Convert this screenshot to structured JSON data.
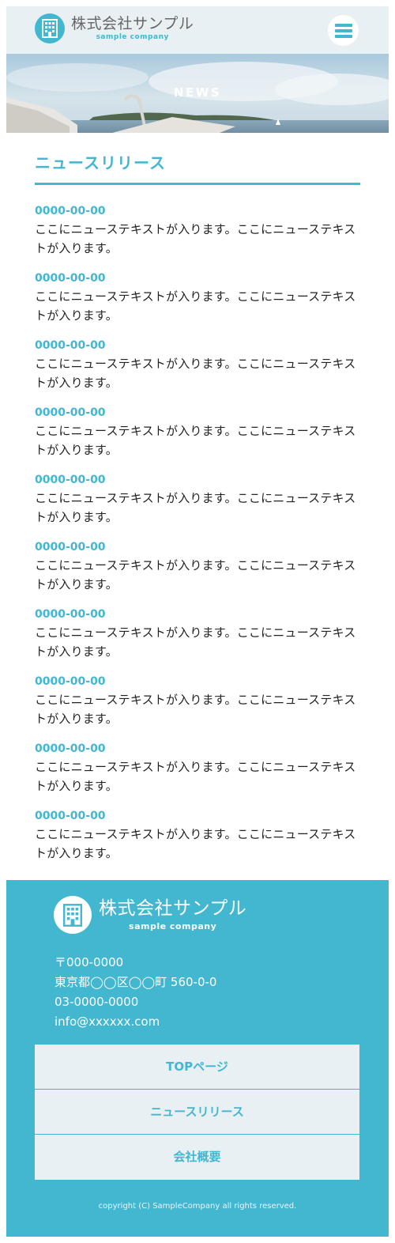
{
  "header": {
    "company_name": "株式会社サンプル",
    "company_sub": "sample company",
    "menu_icon": "hamburger-menu-icon",
    "logo_icon": "building-icon"
  },
  "hero": {
    "title": "NEWS"
  },
  "main": {
    "section_title": "ニュースリリース",
    "news": [
      {
        "date": "0000-00-00",
        "text": "ここにニューステキストが入ります。ここにニューステキストが入ります。"
      },
      {
        "date": "0000-00-00",
        "text": "ここにニューステキストが入ります。ここにニューステキストが入ります。"
      },
      {
        "date": "0000-00-00",
        "text": "ここにニューステキストが入ります。ここにニューステキストが入ります。"
      },
      {
        "date": "0000-00-00",
        "text": "ここにニューステキストが入ります。ここにニューステキストが入ります。"
      },
      {
        "date": "0000-00-00",
        "text": "ここにニューステキストが入ります。ここにニューステキストが入ります。"
      },
      {
        "date": "0000-00-00",
        "text": "ここにニューステキストが入ります。ここにニューステキストが入ります。"
      },
      {
        "date": "0000-00-00",
        "text": "ここにニューステキストが入ります。ここにニューステキストが入ります。"
      },
      {
        "date": "0000-00-00",
        "text": "ここにニューステキストが入ります。ここにニューステキストが入ります。"
      },
      {
        "date": "0000-00-00",
        "text": "ここにニューステキストが入ります。ここにニューステキストが入ります。"
      },
      {
        "date": "0000-00-00",
        "text": "ここにニューステキストが入ります。ここにニューステキストが入ります。"
      }
    ]
  },
  "footer": {
    "company_name": "株式会社サンプル",
    "company_sub": "sample company",
    "postal": "〒000-0000",
    "address": "東京都◯◯区◯◯町 560-0-0",
    "phone": "03-0000-0000",
    "email": "info@xxxxxx.com",
    "nav": [
      {
        "label": "TOPページ"
      },
      {
        "label": "ニュースリリース"
      },
      {
        "label": "会社概要"
      }
    ],
    "copyright": "copyright (C) SampleCompany all rights reserved."
  },
  "colors": {
    "accent": "#43b6d0",
    "header_bg": "#e8f0f3",
    "nav_bg": "#e8f0f3"
  }
}
